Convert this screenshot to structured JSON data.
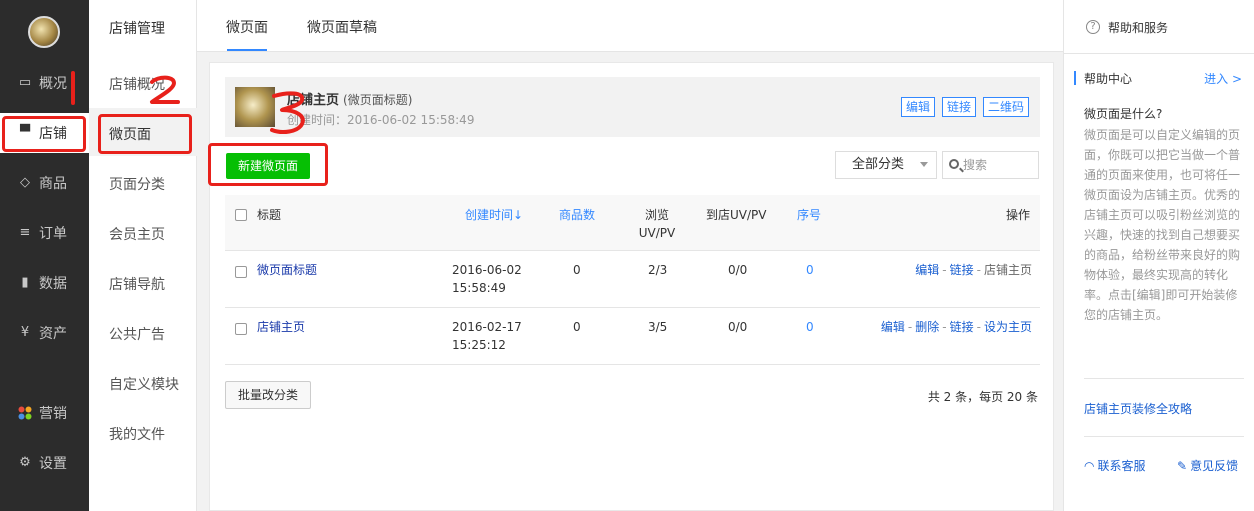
{
  "sidebar": {
    "items": [
      {
        "label": "概况",
        "icon": "monitor-icon"
      },
      {
        "label": "店铺",
        "icon": "store-icon",
        "active": true
      },
      {
        "label": "商品",
        "icon": "tag-icon"
      },
      {
        "label": "订单",
        "icon": "list-icon"
      },
      {
        "label": "数据",
        "icon": "bar-chart-icon"
      },
      {
        "label": "资产",
        "icon": "yen-icon"
      },
      {
        "label": "营销",
        "icon": "apps-icon"
      },
      {
        "label": "设置",
        "icon": "gear-icon"
      }
    ]
  },
  "subnav": {
    "title": "店铺管理",
    "items": [
      "店铺概况",
      "微页面",
      "页面分类",
      "会员主页",
      "店铺导航",
      "公共广告",
      "自定义模块",
      "我的文件"
    ]
  },
  "tabs": [
    "微页面",
    "微页面草稿"
  ],
  "header_card": {
    "title": "店铺主页",
    "subtitle": "(微页面标题)",
    "time": "创建时间：2016-06-02 15:58:49",
    "actions": [
      "编辑",
      "链接",
      "二维码"
    ]
  },
  "toolbar": {
    "new_button": "新建微页面",
    "category_select": "全部分类",
    "search_placeholder": "搜索"
  },
  "table": {
    "headers": {
      "title": "标题",
      "created": "创建时间↓",
      "goods": "商品数",
      "views_line1": "浏览",
      "views_line2": "UV/PV",
      "store_uvpv": "到店UV/PV",
      "order": "序号",
      "ops": "操作"
    },
    "rows": [
      {
        "title": "微页面标题",
        "date": "2016-06-02",
        "time": "15:58:49",
        "goods": "0",
        "views": "2/3",
        "store": "0/0",
        "order": "0",
        "ops": [
          "编辑",
          "链接"
        ],
        "ops_plain": "店铺主页"
      },
      {
        "title": "店铺主页",
        "date": "2016-02-17",
        "time": "15:25:12",
        "goods": "0",
        "views": "3/5",
        "store": "0/0",
        "order": "0",
        "ops": [
          "编辑",
          "删除",
          "链接",
          "设为主页"
        ]
      }
    ]
  },
  "footer": {
    "batch_button": "批量改分类",
    "pager": "共 2 条，每页 20 条"
  },
  "help": {
    "title": "帮助和服务",
    "center_label": "帮助中心",
    "enter": "进入 >",
    "question": "微页面是什么?",
    "body": "微页面是可以自定义编辑的页面，你既可以把它当做一个普通的页面来使用，也可将任一微页面设为店铺主页。优秀的店铺主页可以吸引粉丝浏览的兴趣，快速的找到自己想要买的商品，给粉丝带来良好的购物体验，最终实现高的转化率。点击[编辑]即可开始装修您的店铺主页。",
    "guide_link": "店铺主页装修全攻略",
    "contact": "联系客服",
    "feedback": "意见反馈"
  },
  "annotations": [
    "1",
    "2",
    "3"
  ],
  "colors": {
    "sidebar_bg": "#2c2c2c",
    "accent_blue": "#3388ff",
    "green_button": "#06bf04",
    "annotation_red": "#e8211b"
  }
}
